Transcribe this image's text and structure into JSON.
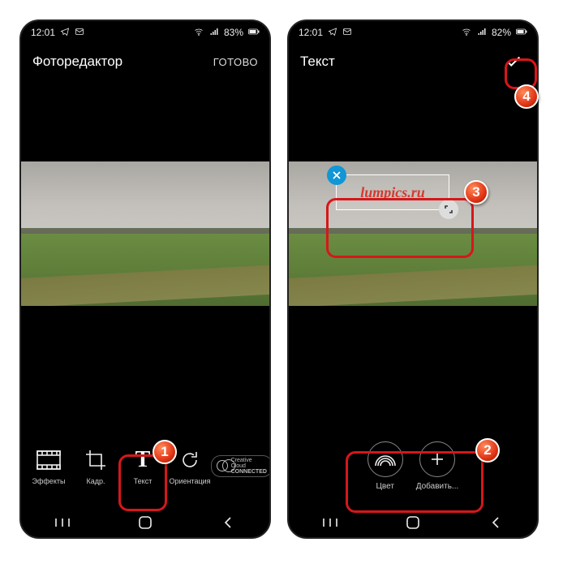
{
  "left": {
    "statusbar": {
      "time": "12:01",
      "battery": "83%"
    },
    "header": {
      "title": "Фоторедактор",
      "done": "ГОТОВО"
    },
    "toolbar": {
      "effects": "Эффекты",
      "crop": "Кадр.",
      "text": "Текст",
      "orient": "Ориентация"
    },
    "cc": {
      "line1": "Creative Cloud",
      "line2": "CONNECTED"
    }
  },
  "right": {
    "statusbar": {
      "time": "12:01",
      "battery": "82%"
    },
    "header": {
      "title": "Текст"
    },
    "toolbar": {
      "color": "Цвет",
      "add": "Добавить..."
    },
    "textOverlay": {
      "value": "lumpics.ru"
    }
  },
  "markers": {
    "m1": "1",
    "m2": "2",
    "m3": "3",
    "m4": "4"
  }
}
